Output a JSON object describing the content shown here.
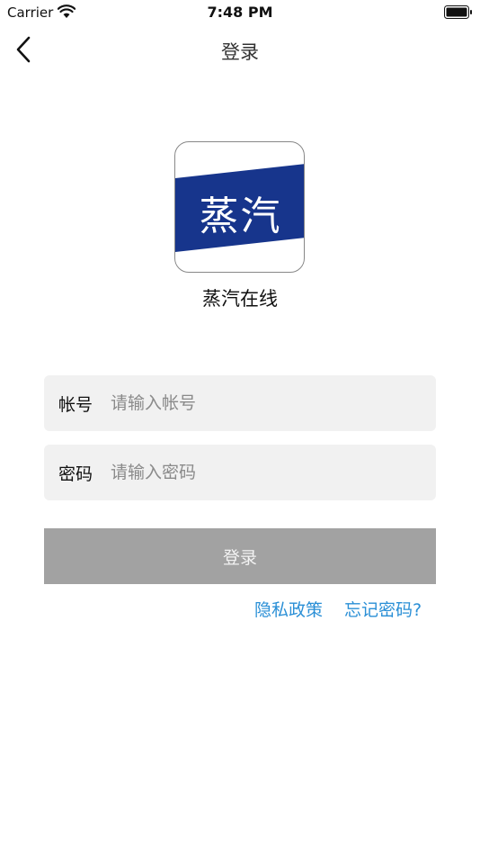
{
  "status": {
    "carrier": "Carrier",
    "time": "7:48 PM"
  },
  "nav": {
    "title": "登录"
  },
  "logo": {
    "text": "蒸汽",
    "band_color": "#17358c"
  },
  "app_name": "蒸汽在线",
  "form": {
    "account_label": "帐号",
    "account_placeholder": "请输入帐号",
    "password_label": "密码",
    "password_placeholder": "请输入密码",
    "login_button": "登录"
  },
  "links": {
    "privacy": "隐私政策",
    "forgot": "忘记密码?"
  },
  "colors": {
    "link": "#2a8fd6",
    "button_bg": "#a2a2a2",
    "field_bg": "#f1f1f1"
  }
}
